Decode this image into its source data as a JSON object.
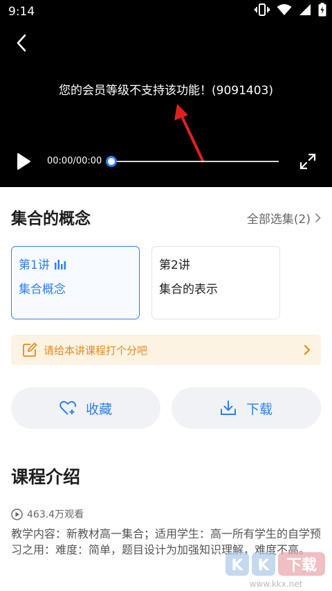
{
  "status_bar": {
    "time": "9:14"
  },
  "player": {
    "error_message": "您的会员等级不支持该功能！(9091403)",
    "time_display": "00:00/00:00",
    "progress": 0.0,
    "accent_color": "#2d7ff0",
    "arrow_color": "#e02020"
  },
  "course": {
    "title": "集合的概念",
    "all_episodes_label": "全部选集(2)"
  },
  "lectures": [
    {
      "number": "第1讲",
      "name": "集合概念",
      "active": true
    },
    {
      "number": "第2讲",
      "name": "集合的表示",
      "active": false
    }
  ],
  "rating_prompt": "请给本讲课程打个分吧",
  "actions": {
    "favorite_label": "收藏",
    "download_label": "下载"
  },
  "intro": {
    "title": "课程介绍",
    "views": "463.4万观看",
    "description": "教学内容：新教材高一集合；适用学生：高一所有学生的自学预习之用：难度：简单，题目设计为加强知识理解，难度不高。"
  },
  "watermark": {
    "text": "KK下载",
    "url": "www.kkx.net"
  },
  "colors": {
    "primary": "#2d7ff0",
    "rating_bg": "#fdf3e3",
    "rating_text": "#e58a1c"
  }
}
